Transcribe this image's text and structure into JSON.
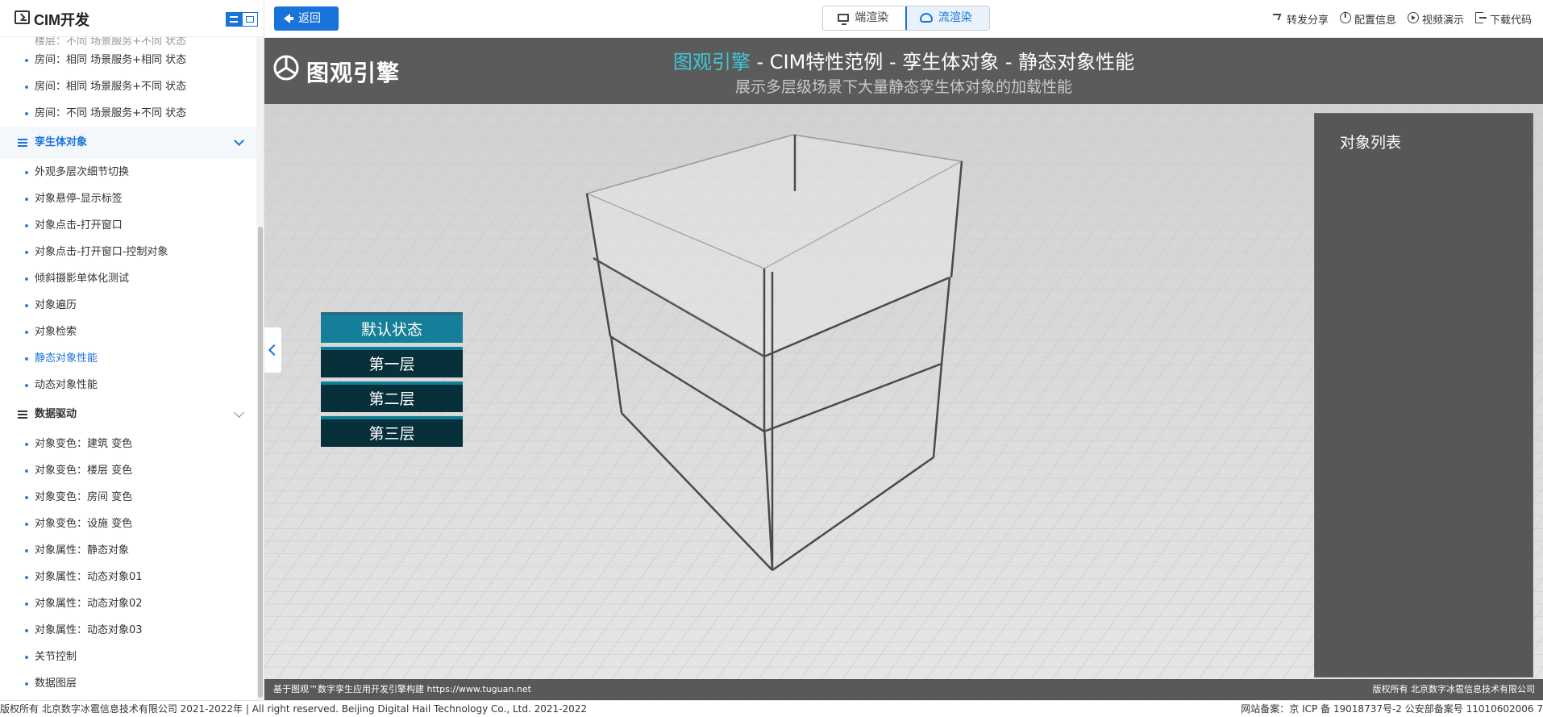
{
  "sidebar": {
    "title": "CIM开发",
    "cut_item": "楼层：不同 场景服务+不同 状态",
    "items_top": [
      "房间：相同 场景服务+相同 状态",
      "房间：相同 场景服务+不同 状态",
      "房间：不同 场景服务+不同 状态"
    ],
    "group_twin": {
      "label": "孪生体对象",
      "items": [
        "外观多层次细节切换",
        "对象悬停-显示标签",
        "对象点击-打开窗口",
        "对象点击-打开窗口-控制对象",
        "倾斜摄影单体化测试",
        "对象遍历",
        "对象检索",
        "静态对象性能",
        "动态对象性能"
      ],
      "active_index": 7
    },
    "group_data": {
      "label": "数据驱动",
      "items": [
        "对象变色：建筑 变色",
        "对象变色：楼层 变色",
        "对象变色：房间 变色",
        "对象变色：设施 变色",
        "对象属性：静态对象",
        "对象属性：动态对象01",
        "对象属性：动态对象02",
        "对象属性：动态对象03",
        "关节控制",
        "数据图层"
      ]
    }
  },
  "topbar": {
    "back_label": "返回",
    "render_client": "端渲染",
    "render_stream": "流渲染",
    "links": {
      "share": "转发分享",
      "config": "配置信息",
      "video": "视频演示",
      "download": "下载代码"
    }
  },
  "viewport": {
    "brand": "图观引擎",
    "title_accent": "图观引擎",
    "title_rest": " - CIM特性范例 - 孪生体对象 - 静态对象性能",
    "subtitle": "展示多层级场景下大量静态孪生体对象的加载性能",
    "floors": [
      "默认状态",
      "第一层",
      "第二层",
      "第三层"
    ],
    "active_floor": 0,
    "object_list_title": "对象列表",
    "footer_left": "基于图观™数字孪生应用开发引擎构建 https://www.tuguan.net",
    "footer_right": "版权所有 北京数字冰雹信息技术有限公司"
  },
  "statusbar": {
    "left": "版权所有 北京数字冰雹信息技术有限公司 2021-2022年 | All right reserved. Beijing Digital Hail Technology Co., Ltd. 2021-2022",
    "right": "网站备案：京 ICP 备 19018737号-2 公安部备案号 11010602006 7"
  },
  "colors": {
    "accent": "#1a73d9",
    "title_accent": "#3ec7d4",
    "floor_active": "#157f9a",
    "floor_default": "#08303a"
  }
}
